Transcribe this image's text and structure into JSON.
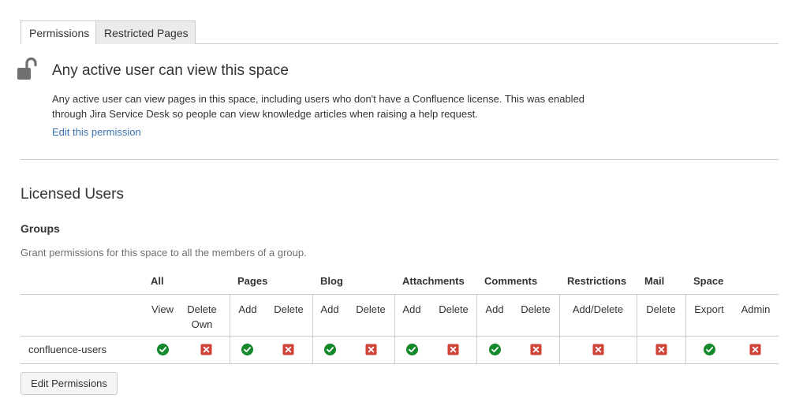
{
  "tabs": [
    {
      "label": "Permissions",
      "active": true
    },
    {
      "label": "Restricted Pages",
      "active": false
    }
  ],
  "public_notice": {
    "icon": "unlocked-padlock-icon",
    "title": "Any active user can view this space",
    "description": "Any active user can view pages in this space, including users who don't have a Confluence license. This was enabled through Jira Service Desk so people can view knowledge articles when raising a help request.",
    "edit_link": "Edit this permission"
  },
  "licensed_users": {
    "heading": "Licensed Users",
    "groups_heading": "Groups",
    "groups_description": "Grant permissions for this space to all the members of a group.",
    "column_groups": [
      "All",
      "Pages",
      "Blog",
      "Attachments",
      "Comments",
      "Restrictions",
      "Mail",
      "Space"
    ],
    "columns": [
      "View",
      "Delete Own",
      "Add",
      "Delete",
      "Add",
      "Delete",
      "Add",
      "Delete",
      "Add",
      "Delete",
      "Add/Delete",
      "Delete",
      "Export",
      "Admin"
    ],
    "rows": [
      {
        "name": "confluence-users",
        "permissions": [
          true,
          false,
          true,
          false,
          true,
          false,
          true,
          false,
          true,
          false,
          false,
          false,
          true,
          false
        ]
      }
    ],
    "edit_button": "Edit Permissions"
  },
  "colors": {
    "granted": "#14892c",
    "denied": "#d04437",
    "link": "#3b73af"
  }
}
